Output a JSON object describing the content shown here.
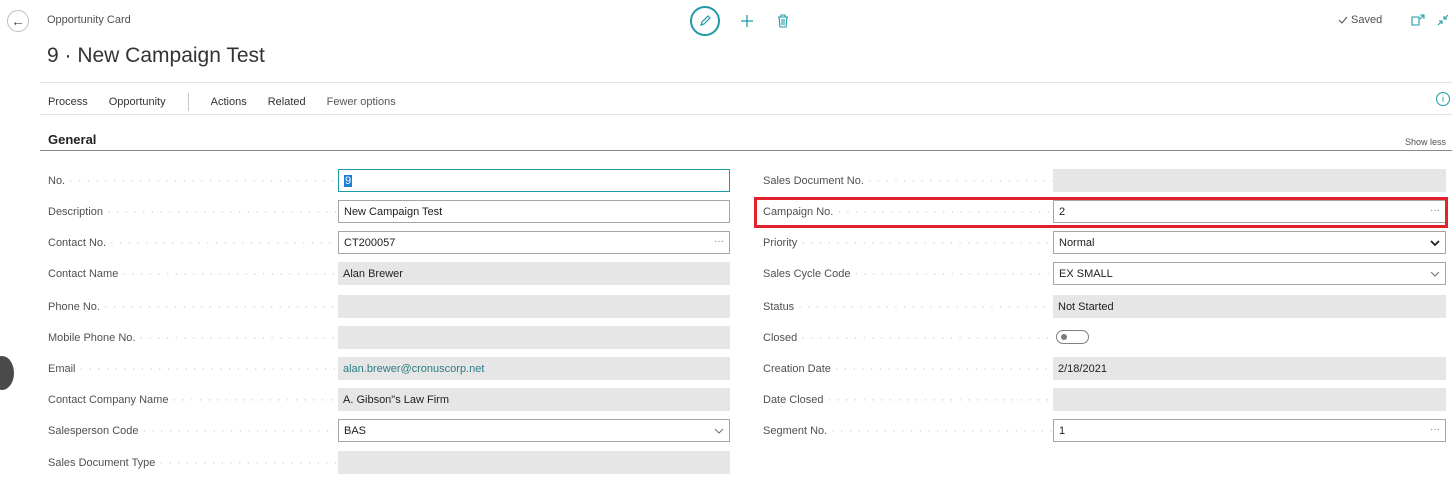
{
  "header": {
    "caption": "Opportunity Card",
    "title": "9 · New Campaign Test",
    "saved_label": "Saved"
  },
  "action_bar": {
    "items": [
      "Process",
      "Opportunity",
      "Actions",
      "Related",
      "Fewer options"
    ]
  },
  "section": {
    "title": "General",
    "show_less": "Show less"
  },
  "left_fields": [
    {
      "label": "No.",
      "value": "9"
    },
    {
      "label": "Description",
      "value": "New Campaign Test"
    },
    {
      "label": "Contact No.",
      "value": "CT200057"
    },
    {
      "label": "Contact Name",
      "value": "Alan Brewer"
    },
    {
      "label": "Phone No.",
      "value": ""
    },
    {
      "label": "Mobile Phone No.",
      "value": ""
    },
    {
      "label": "Email",
      "value": "alan.brewer@cronuscorp.net"
    },
    {
      "label": "Contact Company Name",
      "value": "A. Gibson\"s Law Firm"
    },
    {
      "label": "Salesperson Code",
      "value": "BAS"
    },
    {
      "label": "Sales Document Type",
      "value": ""
    }
  ],
  "right_fields": [
    {
      "label": "Sales Document No.",
      "value": ""
    },
    {
      "label": "Campaign No.",
      "value": "2"
    },
    {
      "label": "Priority",
      "value": "Normal"
    },
    {
      "label": "Sales Cycle Code",
      "value": "EX SMALL"
    },
    {
      "label": "Status",
      "value": "Not Started"
    },
    {
      "label": "Closed",
      "value": false
    },
    {
      "label": "Creation Date",
      "value": "2/18/2021"
    },
    {
      "label": "Date Closed",
      "value": ""
    },
    {
      "label": "Segment No.",
      "value": "1"
    }
  ],
  "colors": {
    "accent": "#1e9aa6",
    "highlight_border": "#e3212d",
    "readonly_bg": "#e6e6e6",
    "link": "#2a7d84"
  }
}
